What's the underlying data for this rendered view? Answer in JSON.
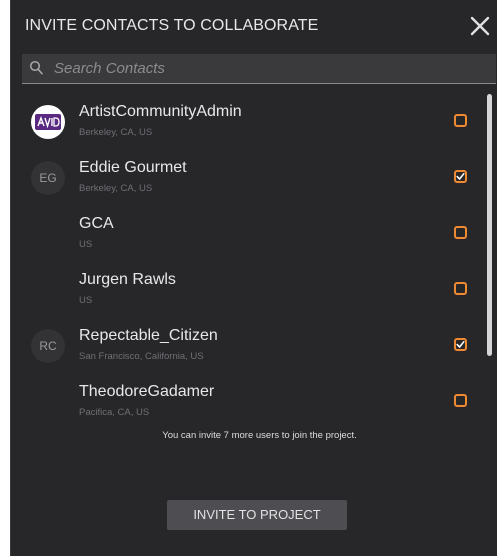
{
  "dialog": {
    "title": "INVITE CONTACTS TO COLLABORATE",
    "close_icon": "close-icon"
  },
  "search": {
    "placeholder": "Search Contacts",
    "value": "",
    "icon": "search-icon"
  },
  "contacts": [
    {
      "name": "ArtistCommunityAdmin",
      "location": "Berkeley, CA, US",
      "avatar_type": "logo",
      "avatar_text": "",
      "checked": false
    },
    {
      "name": "Eddie Gourmet",
      "location": "Berkeley, CA, US",
      "avatar_type": "initials",
      "avatar_text": "EG",
      "checked": true
    },
    {
      "name": "GCA",
      "location": "US",
      "avatar_type": "none",
      "avatar_text": "",
      "checked": false
    },
    {
      "name": "Jurgen Rawls",
      "location": "US",
      "avatar_type": "none",
      "avatar_text": "",
      "checked": false
    },
    {
      "name": "Repectable_Citizen",
      "location": "San Francisco, California, US",
      "avatar_type": "initials",
      "avatar_text": "RC",
      "checked": true
    },
    {
      "name": "TheodoreGadamer",
      "location": "Pacifica, CA, US",
      "avatar_type": "none",
      "avatar_text": "",
      "checked": false
    }
  ],
  "limit_note": "You can invite 7 more users to join the project.",
  "invite_button": "INVITE TO PROJECT",
  "colors": {
    "background": "#27272a",
    "checkbox_accent": "#f08a32",
    "button": "#4d4d52"
  }
}
